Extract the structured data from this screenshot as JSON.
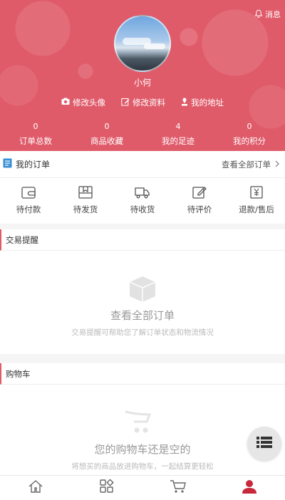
{
  "header": {
    "message_label": "消息",
    "username": "小何",
    "links": [
      {
        "label": "修改头像",
        "icon": "camera-icon"
      },
      {
        "label": "修改资料",
        "icon": "edit-icon"
      },
      {
        "label": "我的地址",
        "icon": "location-icon"
      }
    ],
    "stats": [
      {
        "value": "0",
        "label": "订单总数"
      },
      {
        "value": "0",
        "label": "商品收藏"
      },
      {
        "value": "4",
        "label": "我的足迹"
      },
      {
        "value": "0",
        "label": "我的积分"
      }
    ],
    "accent_color": "#e05b6a"
  },
  "orders": {
    "title": "我的订单",
    "view_all": "查看全部订单",
    "items": [
      {
        "label": "待付款",
        "icon": "wallet-icon"
      },
      {
        "label": "待发货",
        "icon": "package-icon"
      },
      {
        "label": "待收货",
        "icon": "truck-icon"
      },
      {
        "label": "待评价",
        "icon": "pen-icon"
      },
      {
        "label": "退款/售后",
        "icon": "refund-icon"
      }
    ]
  },
  "trade": {
    "title": "交易提醒",
    "empty_title": "查看全部订单",
    "empty_desc": "交易提醒可帮助您了解订单状态和物流情况"
  },
  "cart": {
    "title": "购物车",
    "empty_title": "您的购物车还是空的",
    "empty_desc": "将想买的商品放进购物车，一起结算更轻松"
  },
  "tabbar": {
    "tabs": [
      {
        "icon": "home-icon"
      },
      {
        "icon": "category-icon"
      },
      {
        "icon": "cart-icon"
      },
      {
        "icon": "user-icon",
        "active": true
      }
    ]
  }
}
